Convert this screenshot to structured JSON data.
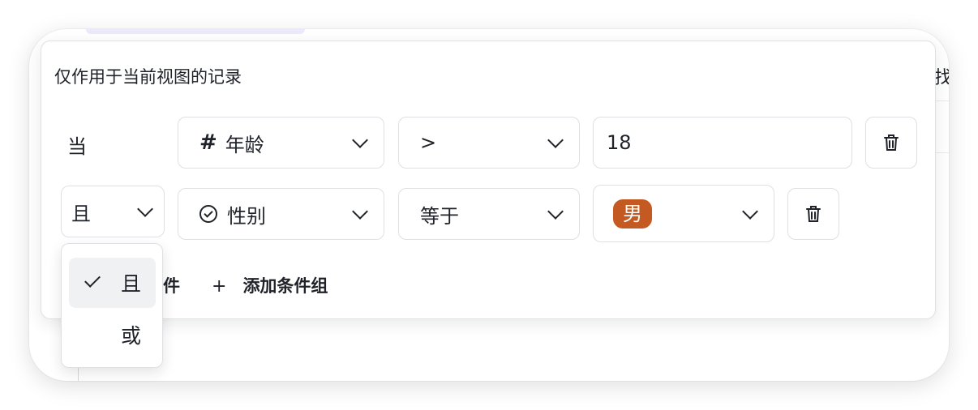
{
  "background_view": {
    "side_text": "找"
  },
  "filter_panel": {
    "title": "仅作用于当前视图的记录",
    "when_label": "当",
    "conditions": [
      {
        "field_icon": "hash-icon",
        "field": "年龄",
        "operator": ">",
        "value": "18"
      },
      {
        "conjunction": "且",
        "field_icon": "clock-check-icon",
        "field": "性别",
        "operator": "等于",
        "value_tag": "男",
        "value_tag_color": "#c45a22"
      }
    ],
    "add_condition_label": "件",
    "add_group_label": "添加条件组"
  },
  "conjunction_dropdown": {
    "options": [
      {
        "label": "且",
        "selected": true
      },
      {
        "label": "或",
        "selected": false
      }
    ]
  },
  "colors": {
    "tag_orange": "#c45a22",
    "border": "#dee0e3",
    "selected_bg": "#f0f1f3"
  }
}
